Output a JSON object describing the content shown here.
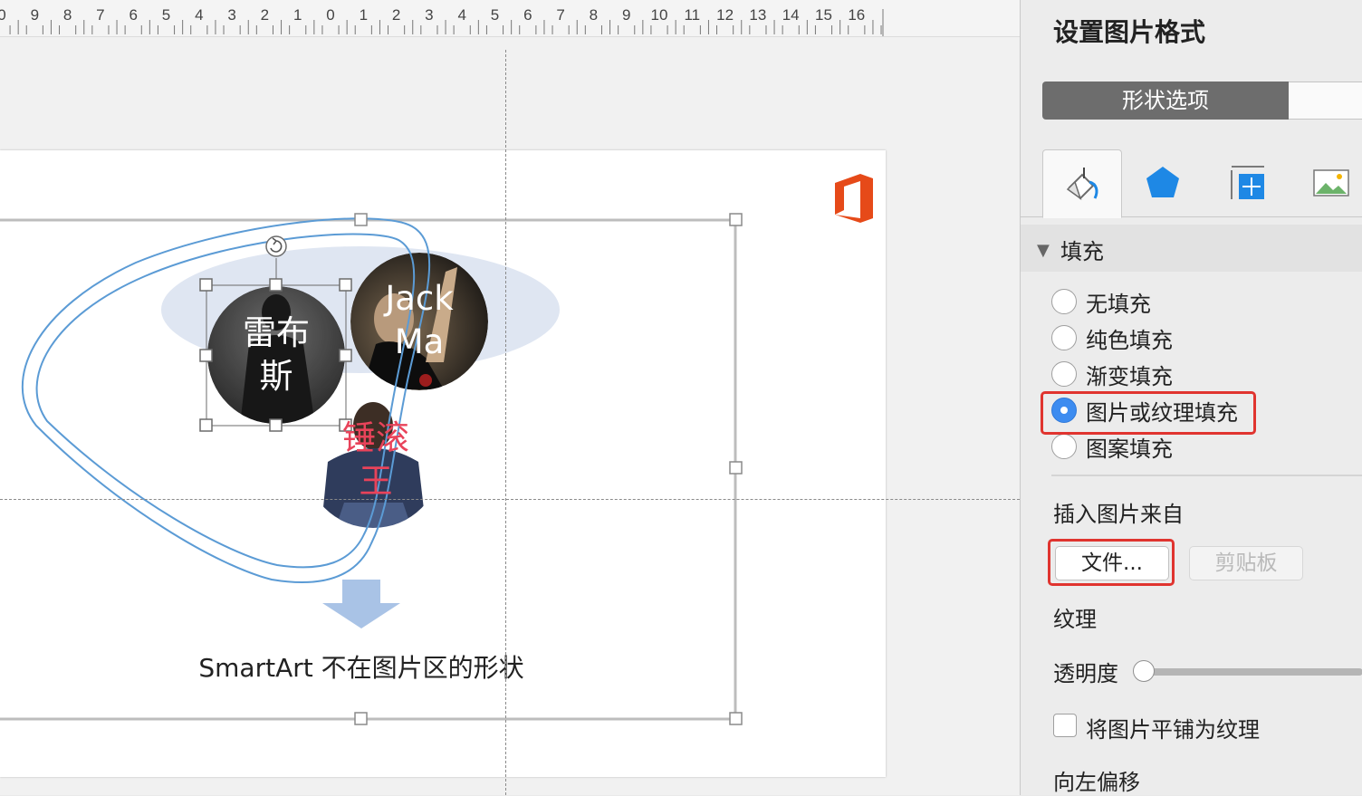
{
  "ruler": {
    "labels": [
      "0",
      "9",
      "8",
      "7",
      "6",
      "5",
      "4",
      "3",
      "2",
      "1",
      "0",
      "1",
      "2",
      "3",
      "4",
      "5",
      "6",
      "7",
      "8",
      "9",
      "10",
      "11",
      "12",
      "13",
      "14",
      "15",
      "16"
    ]
  },
  "slide": {
    "people": [
      {
        "name": "雷布\n斯",
        "label_color": "#ffffff"
      },
      {
        "name": "Jack\nMa",
        "label_color": "#ffffff"
      },
      {
        "name": "锤滚\n王",
        "label_color": "#e8435a"
      }
    ],
    "caption": "SmartArt 不在图片区的形状",
    "colors": {
      "outline": "#5b9bd5",
      "ellipse_fill": "#dfe6f2",
      "arrow": "#a9c3e6",
      "office_logo": "#e64a19"
    }
  },
  "pane": {
    "title": "设置图片格式",
    "segment": {
      "active": "形状选项",
      "inactive": ""
    },
    "tabs": [
      {
        "icon": "paint-bucket-icon"
      },
      {
        "icon": "pentagon-icon"
      },
      {
        "icon": "size-position-icon"
      },
      {
        "icon": "picture-icon"
      }
    ],
    "fill_section": {
      "title": "填充",
      "options": [
        {
          "label": "无填充",
          "selected": false
        },
        {
          "label": "纯色填充",
          "selected": false
        },
        {
          "label": "渐变填充",
          "selected": false
        },
        {
          "label": "图片或纹理填充",
          "selected": true
        },
        {
          "label": "图案填充",
          "selected": false
        }
      ]
    },
    "insert_from": {
      "label": "插入图片来自",
      "file_button": "文件...",
      "clipboard_button": "剪贴板"
    },
    "texture_label": "纹理",
    "transparency": {
      "label": "透明度",
      "value": 0
    },
    "tile_checkbox": {
      "label": "将图片平铺为纹理",
      "checked": false
    },
    "offset_left_label": "向左偏移",
    "accent_color": "#3d8cf0",
    "highlight_color": "#e0342f"
  }
}
